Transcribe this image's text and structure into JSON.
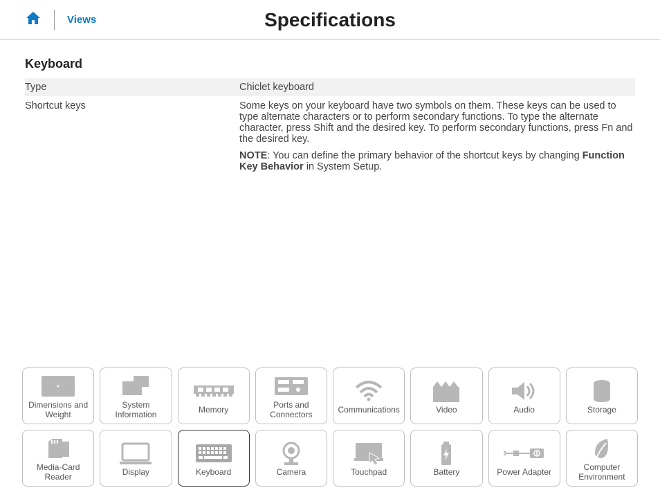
{
  "header": {
    "views_label": "Views",
    "title": "Specifications"
  },
  "section": {
    "heading": "Keyboard",
    "rows": [
      {
        "label": "Type",
        "value": "Chiclet keyboard"
      },
      {
        "label": "Shortcut keys",
        "value": "Some keys on your keyboard have two symbols on them. These keys can be used to type alternate characters or to perform secondary functions. To type the alternate character, press Shift and the desired key. To perform secondary functions, press Fn and the desired key."
      }
    ],
    "note_prefix": "NOTE",
    "note_text_before": ": You can define the primary behavior of the shortcut keys by changing ",
    "note_bold": "Function Key Behavior",
    "note_text_after": " in System Setup."
  },
  "nav": {
    "row1": [
      {
        "label": "Dimensions and Weight"
      },
      {
        "label": "System Information"
      },
      {
        "label": "Memory"
      },
      {
        "label": "Ports and Connectors"
      },
      {
        "label": "Communications"
      },
      {
        "label": "Video"
      },
      {
        "label": "Audio"
      },
      {
        "label": "Storage"
      }
    ],
    "row2": [
      {
        "label": "Media-Card Reader"
      },
      {
        "label": "Display"
      },
      {
        "label": "Keyboard"
      },
      {
        "label": "Camera"
      },
      {
        "label": "Touchpad"
      },
      {
        "label": "Battery"
      },
      {
        "label": "Power Adapter"
      },
      {
        "label": "Computer Environment"
      }
    ]
  }
}
